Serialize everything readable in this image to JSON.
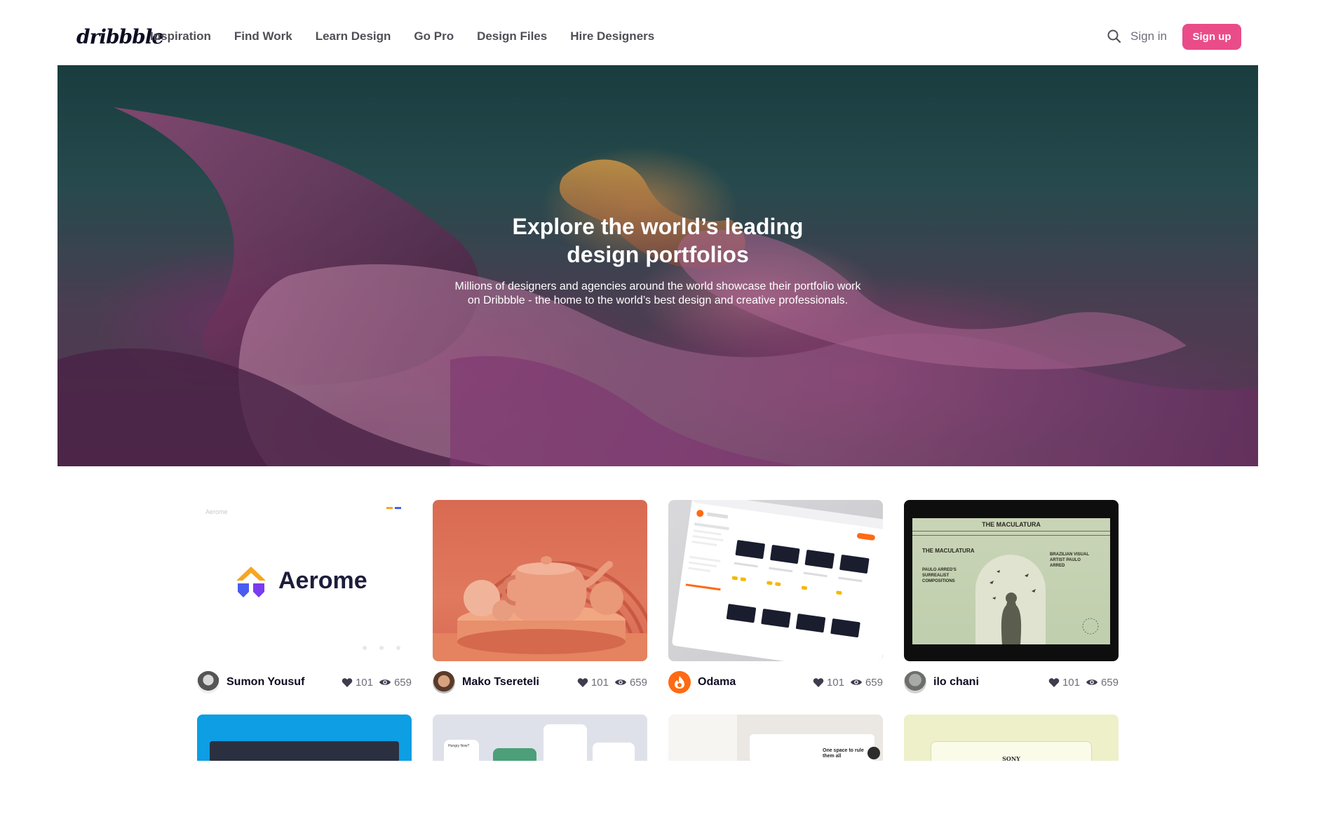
{
  "header": {
    "logo": "dribbble",
    "nav": [
      "Inspiration",
      "Find Work",
      "Learn Design",
      "Go Pro",
      "Design Files",
      "Hire Designers"
    ],
    "signin": "Sign in",
    "signup": "Sign up"
  },
  "hero": {
    "title_line1": "Explore the world’s leading",
    "title_line2": "design portfolios",
    "sub_line1": "Millions of designers and agencies around the world showcase their portfolio work",
    "sub_line2": "on Dribbble - the home to the world’s best design and creative professionals."
  },
  "shots": [
    {
      "author": "Sumon Yousuf",
      "likes": "101",
      "views": "659",
      "title_text": "Aerome",
      "small_brand": "Aerome"
    },
    {
      "author": "Mako Tsereteli",
      "likes": "101",
      "views": "659"
    },
    {
      "author": "Odama",
      "likes": "101",
      "views": "659"
    },
    {
      "author": "ilo chani",
      "likes": "101",
      "views": "659",
      "poster_title": "THE MACULATURA",
      "poster_heading": "THE MACULATURA",
      "poster_side": "BRAZILIAN VISUAL ARTIST PAULO ARRED",
      "poster_left": "PAULO ARRED'S SURREALIST COMPOSITIONS"
    }
  ],
  "row2": [
    {
      "label": ""
    },
    {
      "label": "Hungry Now?"
    },
    {
      "label": "One space to rule them all"
    },
    {
      "label": "SONY"
    }
  ],
  "colors": {
    "accent": "#ea4c89",
    "heading": "#0d0c22",
    "muted": "#6e6d7a"
  }
}
